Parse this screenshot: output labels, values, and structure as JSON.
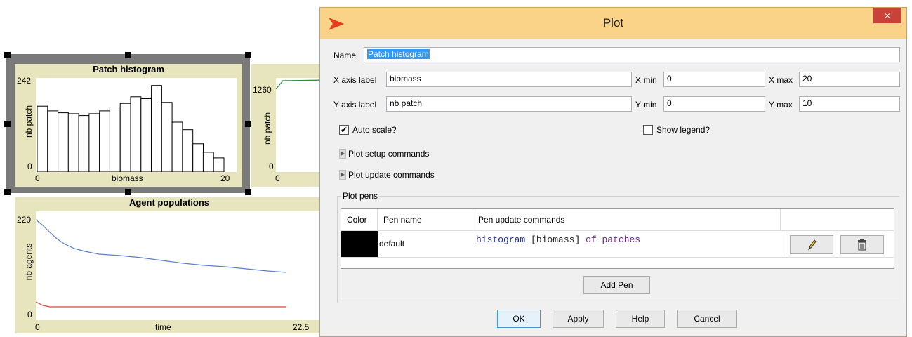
{
  "histogram_plot": {
    "title": "Patch histogram",
    "y_max_label": "242",
    "y_min_label": "0",
    "x_min_label": "0",
    "x_max_label": "20",
    "x_label": "biomass",
    "y_label": "nb patch",
    "bars": [
      0.7,
      0.65,
      0.63,
      0.62,
      0.6,
      0.62,
      0.65,
      0.69,
      0.73,
      0.8,
      0.78,
      0.92,
      0.74,
      0.53,
      0.45,
      0.3,
      0.21,
      0.15
    ]
  },
  "biomass_plot": {
    "y_max_label": "1260",
    "y_label": "nb patch",
    "y_min_label": "0",
    "x_min_label": "0"
  },
  "agents_plot": {
    "title": "Agent populations",
    "y_max_label": "220",
    "y_min_label": "0",
    "x_min_label": "0",
    "x_max_label": "22.5",
    "x_label": "time",
    "y_label": "nb agents",
    "blue_color": "#5a7ec9",
    "red_color": "#e0443a"
  },
  "dialog": {
    "title": "Plot",
    "close_label": "×",
    "accent_color": "#e63c1f",
    "name_label": "Name",
    "name_value": "Patch histogram",
    "x_axis_label_label": "X axis label",
    "x_axis_label_value": "biomass",
    "x_min_label": "X min",
    "x_min_value": "0",
    "x_max_label": "X max",
    "x_max_value": "20",
    "y_axis_label_label": "Y axis label",
    "y_axis_label_value": "nb patch",
    "y_min_label": "Y min",
    "y_min_value": "0",
    "y_max_label": "Y max",
    "y_max_value": "10",
    "auto_scale_label": "Auto scale?",
    "auto_scale_checked": true,
    "show_legend_label": "Show legend?",
    "show_legend_checked": false,
    "setup_commands_label": "Plot setup commands",
    "update_commands_label": "Plot update commands",
    "pens_group_label": "Plot pens",
    "pens_headers": {
      "color": "Color",
      "name": "Pen name",
      "commands": "Pen update commands"
    },
    "pen": {
      "color": "#000000",
      "name": "default",
      "cmd_keyword": "histogram",
      "cmd_bracket": "[biomass]",
      "cmd_of": "of",
      "cmd_patches": "patches"
    },
    "add_pen_label": "Add Pen",
    "ok_label": "OK",
    "apply_label": "Apply",
    "help_label": "Help",
    "cancel_label": "Cancel"
  }
}
